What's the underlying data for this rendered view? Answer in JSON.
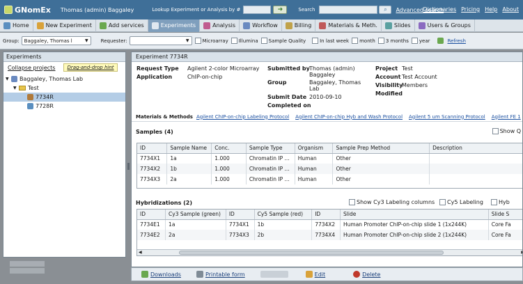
{
  "header": {
    "app_name": "GNomEx",
    "user": "Thomas (admin) Baggaley",
    "lookup_label": "Lookup Experiment or Analysis by #",
    "search_label": "Search",
    "advanced_search": "Advanced search",
    "links": [
      "Dictionaries",
      "Pricing",
      "Help",
      "About"
    ]
  },
  "nav": {
    "items": [
      {
        "label": "Home",
        "icon": "home-icon",
        "color": "#5a8fc0"
      },
      {
        "label": "New Experiment",
        "icon": "new-experiment-icon",
        "color": "#d9a23a"
      },
      {
        "label": "Add services",
        "icon": "add-services-icon",
        "color": "#6aa84f"
      },
      {
        "label": "Experiments",
        "icon": "experiments-icon",
        "color": "#e0e8f0"
      },
      {
        "label": "Analysis",
        "icon": "analysis-icon",
        "color": "#c05a8f"
      },
      {
        "label": "Workflow",
        "icon": "workflow-icon",
        "color": "#6a8ac0"
      },
      {
        "label": "Billing",
        "icon": "billing-icon",
        "color": "#c0a24a"
      },
      {
        "label": "Materials & Meth.",
        "icon": "materials-icon",
        "color": "#c05a5a"
      },
      {
        "label": "Slides",
        "icon": "slides-icon",
        "color": "#5aa0a0"
      },
      {
        "label": "Users & Groups",
        "icon": "users-icon",
        "color": "#8a6ac0"
      }
    ]
  },
  "filters": {
    "group_label": "Group:",
    "group_value": "Baggaley, Thomas l",
    "requester_label": "Requester:",
    "requester_value": "",
    "checks": [
      "Microarray",
      "Illumina",
      "Sample Quality",
      "In last week",
      "month",
      "3 months",
      "year"
    ],
    "refresh": "Refresh"
  },
  "left": {
    "title": "Experiments",
    "collapse": "Collapse projects",
    "hint": "Drag-and-drop hint",
    "tree": [
      {
        "label": "Baggaley, Thomas Lab",
        "level": 0,
        "type": "lab"
      },
      {
        "label": "Test",
        "level": 1,
        "type": "folder"
      },
      {
        "label": "7734R",
        "level": 2,
        "type": "experiment",
        "selected": true
      },
      {
        "label": "7728R",
        "level": 2,
        "type": "experiment"
      }
    ]
  },
  "detail": {
    "title": "Experiment 7734R",
    "request_type_label": "Request Type",
    "request_type": "Agilent 2-color Microarray",
    "application_label": "Application",
    "application": "ChIP-on-chip",
    "submitted_by_label": "Submitted by",
    "submitted_by": "Thomas (admin) Baggaley",
    "group_label": "Group",
    "group": "Baggaley, Thomas Lab",
    "submit_date_label": "Submit Date",
    "submit_date": "2010-09-10",
    "completed_on_label": "Completed on",
    "completed_on": "",
    "project_label": "Project",
    "project": "Test",
    "account_label": "Account",
    "account": "Test Account",
    "visibility_label": "Visibility",
    "visibility": "Members",
    "modified_label": "Modified",
    "modified": "",
    "materials_label": "Materials & Methods",
    "protocols": [
      "Agilent ChIP-on-chip Labeling Protocol",
      "Agilent ChIP-on-chip Hyb and Wash Protocol",
      "Agilent 5 um Scanning Protocol",
      "Agilent FE 1"
    ]
  },
  "samples": {
    "title": "Samples (4)",
    "show_label": "Show Q",
    "columns": [
      "ID",
      "Sample Name",
      "Conc.",
      "Sample Type",
      "Organism",
      "Sample Prep Method",
      "Description"
    ],
    "rows": [
      [
        "7734X1",
        "1a",
        "1.000",
        "Chromatin IP ...",
        "Human",
        "Other",
        ""
      ],
      [
        "7734X2",
        "1b",
        "1.000",
        "Chromatin IP ...",
        "Human",
        "Other",
        ""
      ],
      [
        "7734X3",
        "2a",
        "1.000",
        "Chromatin IP ...",
        "Human",
        "Other",
        ""
      ]
    ]
  },
  "hybs": {
    "title": "Hybridizations (2)",
    "opts": [
      "Show Cy3 Labeling columns",
      "Cy5 Labeling",
      "Hyb"
    ],
    "columns": [
      "ID",
      "Cy3 Sample (green)",
      "ID",
      "Cy5 Sample (red)",
      "ID",
      "Slide",
      "Slide S"
    ],
    "rows": [
      [
        "7734E1",
        "1a",
        "7734X1",
        "1b",
        "7734X2",
        "Human Promoter ChIP-on-chip slide 1 (1x244K)",
        "Core Fa"
      ],
      [
        "7734E2",
        "2a",
        "7734X3",
        "2b",
        "7734X4",
        "Human Promoter ChIP-on-chip slide 2 (1x244K)",
        "Core Fa"
      ]
    ]
  },
  "actions": {
    "downloads": "Downloads",
    "printable": "Printable form",
    "edit": "Edit",
    "delete": "Delete"
  }
}
